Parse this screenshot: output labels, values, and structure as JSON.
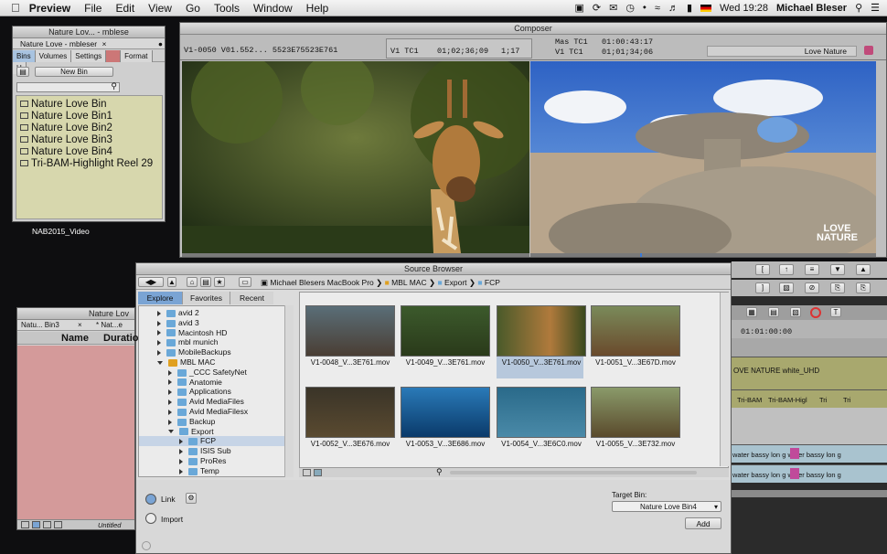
{
  "menubar": {
    "items": [
      "Preview",
      "File",
      "Edit",
      "View",
      "Go",
      "Tools",
      "Window",
      "Help"
    ],
    "clock": "Wed 19:28",
    "user": "Michael Bleser"
  },
  "bin_window": {
    "title": "Nature Lov... - mblese",
    "tab_title": "Nature Love - mbleser",
    "tabs": [
      "Bins",
      "Volumes",
      "Settings",
      "",
      "Format",
      "U"
    ],
    "new_bin": "New Bin",
    "items": [
      "Nature Love Bin",
      "Nature Love Bin1",
      "Nature Love Bin2",
      "Nature Love Bin3",
      "Nature Love Bin4",
      "Tri-BAM-Highlight Reel 29"
    ],
    "caption": "NAB2015_Video"
  },
  "composer": {
    "title": "Composer",
    "src_clip": "V1-0050 V01.552... 5523E75523E761",
    "tc_left_label": "V1  TC1",
    "tc_left_value": "01;02;36;09",
    "tc_dur": "1;17",
    "tc_mas_label": "Mas TC1",
    "tc_mas_value": "01:00:43:17",
    "tc_v1_label": "V1  TC1",
    "tc_v1_value": "01;01;34;06",
    "sequence": "Love Nature",
    "logo_line1": "LOVE",
    "logo_line2": "NATURE"
  },
  "source_browser": {
    "title": "Source Browser",
    "path": [
      "Michael Blesers MacBook Pro",
      "MBL MAC",
      "Export",
      "FCP"
    ],
    "tabs": [
      "Explore",
      "Favorites",
      "Recent"
    ],
    "tree": [
      {
        "label": "avid 2",
        "indent": 1,
        "open": false
      },
      {
        "label": "avid 3",
        "indent": 1,
        "open": false
      },
      {
        "label": "Macintosh HD",
        "indent": 1,
        "open": false
      },
      {
        "label": "mbl munich",
        "indent": 1,
        "open": false
      },
      {
        "label": "MobileBackups",
        "indent": 1,
        "open": false
      },
      {
        "label": "MBL MAC",
        "indent": 1,
        "open": true
      },
      {
        "label": "_CCC SafetyNet",
        "indent": 2,
        "open": false
      },
      {
        "label": "Anatomie",
        "indent": 2,
        "open": false
      },
      {
        "label": "Applications",
        "indent": 2,
        "open": false
      },
      {
        "label": "Avid MediaFiles",
        "indent": 2,
        "open": false
      },
      {
        "label": "Avid MediaFilesx",
        "indent": 2,
        "open": false
      },
      {
        "label": "Backup",
        "indent": 2,
        "open": false
      },
      {
        "label": "Export",
        "indent": 2,
        "open": true
      },
      {
        "label": "FCP",
        "indent": 3,
        "open": false
      },
      {
        "label": "ISIS Sub",
        "indent": 3,
        "open": false
      },
      {
        "label": "ProRes",
        "indent": 3,
        "open": false
      },
      {
        "label": "Temp",
        "indent": 3,
        "open": false
      }
    ],
    "clips": [
      "V1-0048_V...3E761.mov",
      "V1-0049_V...3E761.mov",
      "V1-0050_V...3E761.mov",
      "V1-0051_V...3E67D.mov",
      "V1-0052_V...3E676.mov",
      "V1-0053_V...3E686.mov",
      "V1-0054_V...3E6C0.mov",
      "V1-0055_V...3E732.mov"
    ],
    "link_label": "Link",
    "import_label": "Import",
    "target_bin_label": "Target Bin:",
    "target_bin_value": "Nature Love Bin4",
    "add_button": "Add"
  },
  "bin2": {
    "title": "Nature Lov",
    "tab1": "Natu... Bin3",
    "tab2": "* Nat...e Bin",
    "col_name": "Name",
    "col_dur": "Duratio",
    "status": "Untitled"
  },
  "timeline": {
    "tc": "01:01:00:00",
    "track_title": "OVE NATURE white_UHD",
    "clips": [
      "Tri-BAM",
      "Tri-BAM-Higl",
      "Tri",
      "Tri"
    ],
    "audio1": "water bassy lon g water bassy lon g",
    "audio2": "water bassy lon g water bassy lon g"
  },
  "colors": {
    "bin_list_bg": "#d7d7ad",
    "selection": "#a8c3e0",
    "bin2_bg": "#d49a9a"
  }
}
